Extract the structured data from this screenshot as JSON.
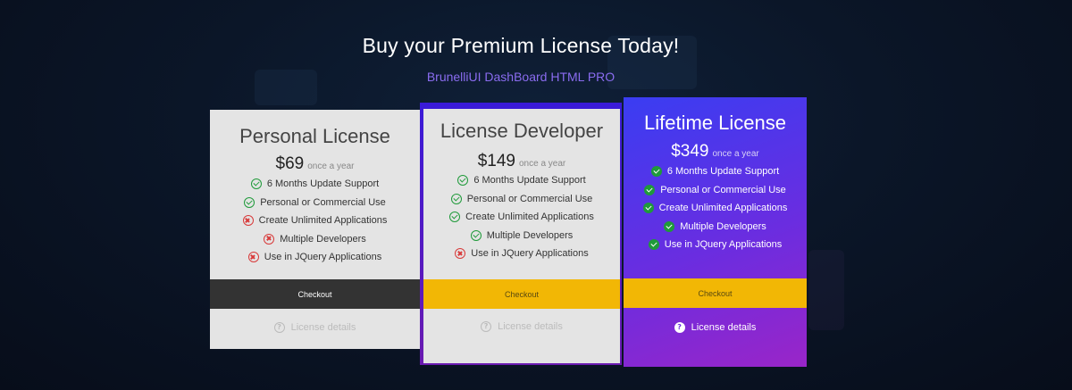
{
  "hero": {
    "title": "Buy your Premium License Today!",
    "subtitle": "BrunelliUI DashBoard HTML PRO"
  },
  "plans": [
    {
      "name": "Personal License",
      "price": "$69",
      "period": "once a year",
      "features": [
        {
          "label": "6 Months Update Support",
          "included": true
        },
        {
          "label": "Personal or Commercial Use",
          "included": true
        },
        {
          "label": "Create Unlimited Applications",
          "included": false
        },
        {
          "label": "Multiple Developers",
          "included": false
        },
        {
          "label": "Use in JQuery Applications",
          "included": false
        }
      ],
      "checkout_label": "Checkout",
      "details_label": "License details"
    },
    {
      "name": "License Developer",
      "price": "$149",
      "period": "once a year",
      "features": [
        {
          "label": "6 Months Update Support",
          "included": true
        },
        {
          "label": "Personal or Commercial Use",
          "included": true
        },
        {
          "label": "Create Unlimited Applications",
          "included": true
        },
        {
          "label": "Multiple Developers",
          "included": true
        },
        {
          "label": "Use in JQuery Applications",
          "included": false
        }
      ],
      "checkout_label": "Checkout",
      "details_label": "License details"
    },
    {
      "name": "Lifetime License",
      "price": "$349",
      "period": "once a year",
      "features": [
        {
          "label": "6 Months Update Support",
          "included": true
        },
        {
          "label": "Personal or Commercial Use",
          "included": true
        },
        {
          "label": "Create Unlimited Applications",
          "included": true
        },
        {
          "label": "Multiple Developers",
          "included": true
        },
        {
          "label": "Use in JQuery Applications",
          "included": true
        }
      ],
      "checkout_label": "Checkout",
      "details_label": "License details"
    }
  ],
  "colors": {
    "dark_checkout": "#333333",
    "yellow_checkout": "#f2b705",
    "included_green": "#1f9a3a",
    "excluded_red": "#d83a3a",
    "subtitle_purple": "#8a6cf0"
  }
}
